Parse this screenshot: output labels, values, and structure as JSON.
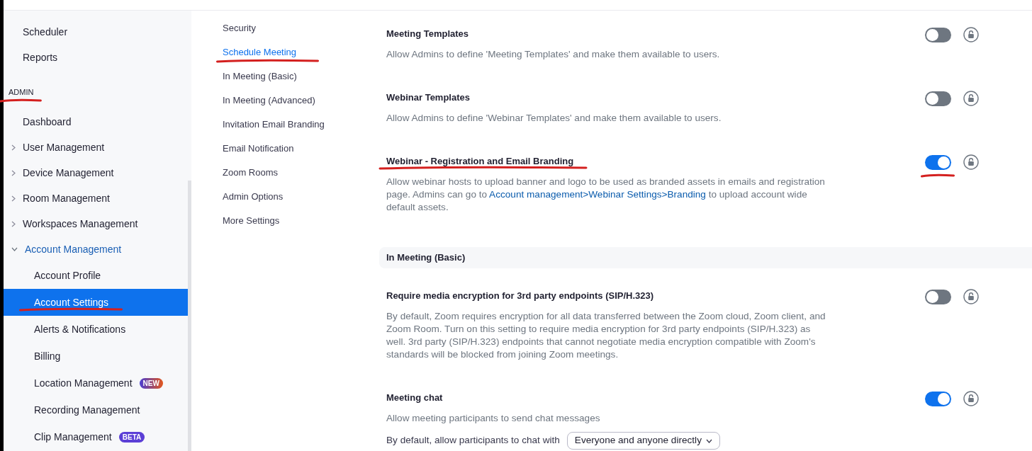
{
  "sidebar": {
    "items": [
      {
        "kind": "link",
        "label": "Scheduler",
        "selected": false,
        "marked": false
      },
      {
        "kind": "link",
        "label": "Reports",
        "selected": false,
        "marked": false
      },
      {
        "kind": "heading",
        "label": "ADMIN",
        "marked": true
      },
      {
        "kind": "link",
        "label": "Dashboard",
        "selected": false,
        "marked": false
      },
      {
        "kind": "group",
        "label": "User Management",
        "expanded": false,
        "selected": false,
        "marked": false
      },
      {
        "kind": "group",
        "label": "Device Management",
        "expanded": false,
        "selected": false,
        "marked": false
      },
      {
        "kind": "group",
        "label": "Room Management",
        "expanded": false,
        "selected": false,
        "marked": false
      },
      {
        "kind": "group",
        "label": "Workspaces Management",
        "expanded": false,
        "selected": false,
        "marked": false
      },
      {
        "kind": "group",
        "label": "Account Management",
        "expanded": true,
        "selected": false,
        "marked": false,
        "children": [
          {
            "label": "Account Profile",
            "selected": false,
            "marked": false
          },
          {
            "label": "Account Settings",
            "selected": true,
            "marked": true
          },
          {
            "label": "Alerts & Notifications",
            "selected": false,
            "marked": false
          },
          {
            "label": "Billing",
            "selected": false,
            "marked": false
          },
          {
            "label": "Location Management",
            "selected": false,
            "marked": false,
            "badge": {
              "text": "NEW",
              "kind": "new"
            }
          },
          {
            "label": "Recording Management",
            "selected": false,
            "marked": false
          },
          {
            "label": "Clip Management",
            "selected": false,
            "marked": false,
            "badge": {
              "text": "BETA",
              "kind": "beta"
            }
          }
        ]
      }
    ]
  },
  "settings_nav": {
    "items": [
      {
        "label": "Security",
        "selected": false,
        "marked": false
      },
      {
        "label": "Schedule Meeting",
        "selected": true,
        "marked": true
      },
      {
        "label": "In Meeting (Basic)",
        "selected": false,
        "marked": false
      },
      {
        "label": "In Meeting (Advanced)",
        "selected": false,
        "marked": false
      },
      {
        "label": "Invitation Email Branding",
        "selected": false,
        "marked": false
      },
      {
        "label": "Email Notification",
        "selected": false,
        "marked": false
      },
      {
        "label": "Zoom Rooms",
        "selected": false,
        "marked": false
      },
      {
        "label": "Admin Options",
        "selected": false,
        "marked": false
      },
      {
        "label": "More Settings",
        "selected": false,
        "marked": false
      }
    ]
  },
  "content": {
    "items": [
      {
        "kind": "setting",
        "title": "Meeting Templates",
        "description": [
          {
            "kind": "text",
            "text": "Allow Admins to define 'Meeting Templates' and make them available to users."
          }
        ],
        "on": false,
        "title_marked": false,
        "switch_marked": false
      },
      {
        "kind": "setting",
        "title": "Webinar Templates",
        "description": [
          {
            "kind": "text",
            "text": "Allow Admins to define 'Webinar Templates' and make them available to users."
          }
        ],
        "on": false,
        "title_marked": false,
        "switch_marked": false
      },
      {
        "kind": "setting",
        "title": "Webinar - Registration and Email Branding",
        "description": [
          {
            "kind": "text",
            "text": "Allow webinar hosts to upload banner and logo to be used as branded assets in emails and registration page. Admins can go to "
          },
          {
            "kind": "link",
            "text": "Account management>Webinar Settings>Branding"
          },
          {
            "kind": "text",
            "text": " to upload account wide default assets."
          }
        ],
        "on": true,
        "title_marked": true,
        "switch_marked": true
      },
      {
        "kind": "section",
        "title": "In Meeting (Basic)"
      },
      {
        "kind": "setting",
        "title": "Require media encryption for 3rd party endpoints (SIP/H.323)",
        "description": [
          {
            "kind": "text",
            "text": "By default, Zoom requires encryption for all data transferred between the Zoom cloud, Zoom client, and Zoom Room. Turn on this setting to require media encryption for 3rd party endpoints (SIP/H.323) as well. 3rd party (SIP/H.323) endpoints that cannot negotiate media encryption compatible with Zoom's standards will be blocked from joining Zoom meetings."
          }
        ],
        "on": false,
        "title_marked": false,
        "switch_marked": false
      },
      {
        "kind": "setting",
        "title": "Meeting chat",
        "description": [
          {
            "kind": "text",
            "text": "Allow meeting participants to send chat messages"
          }
        ],
        "on": true,
        "title_marked": false,
        "switch_marked": false,
        "option": {
          "label": "By default, allow participants to chat with",
          "value": "Everyone and anyone directly"
        }
      }
    ]
  }
}
